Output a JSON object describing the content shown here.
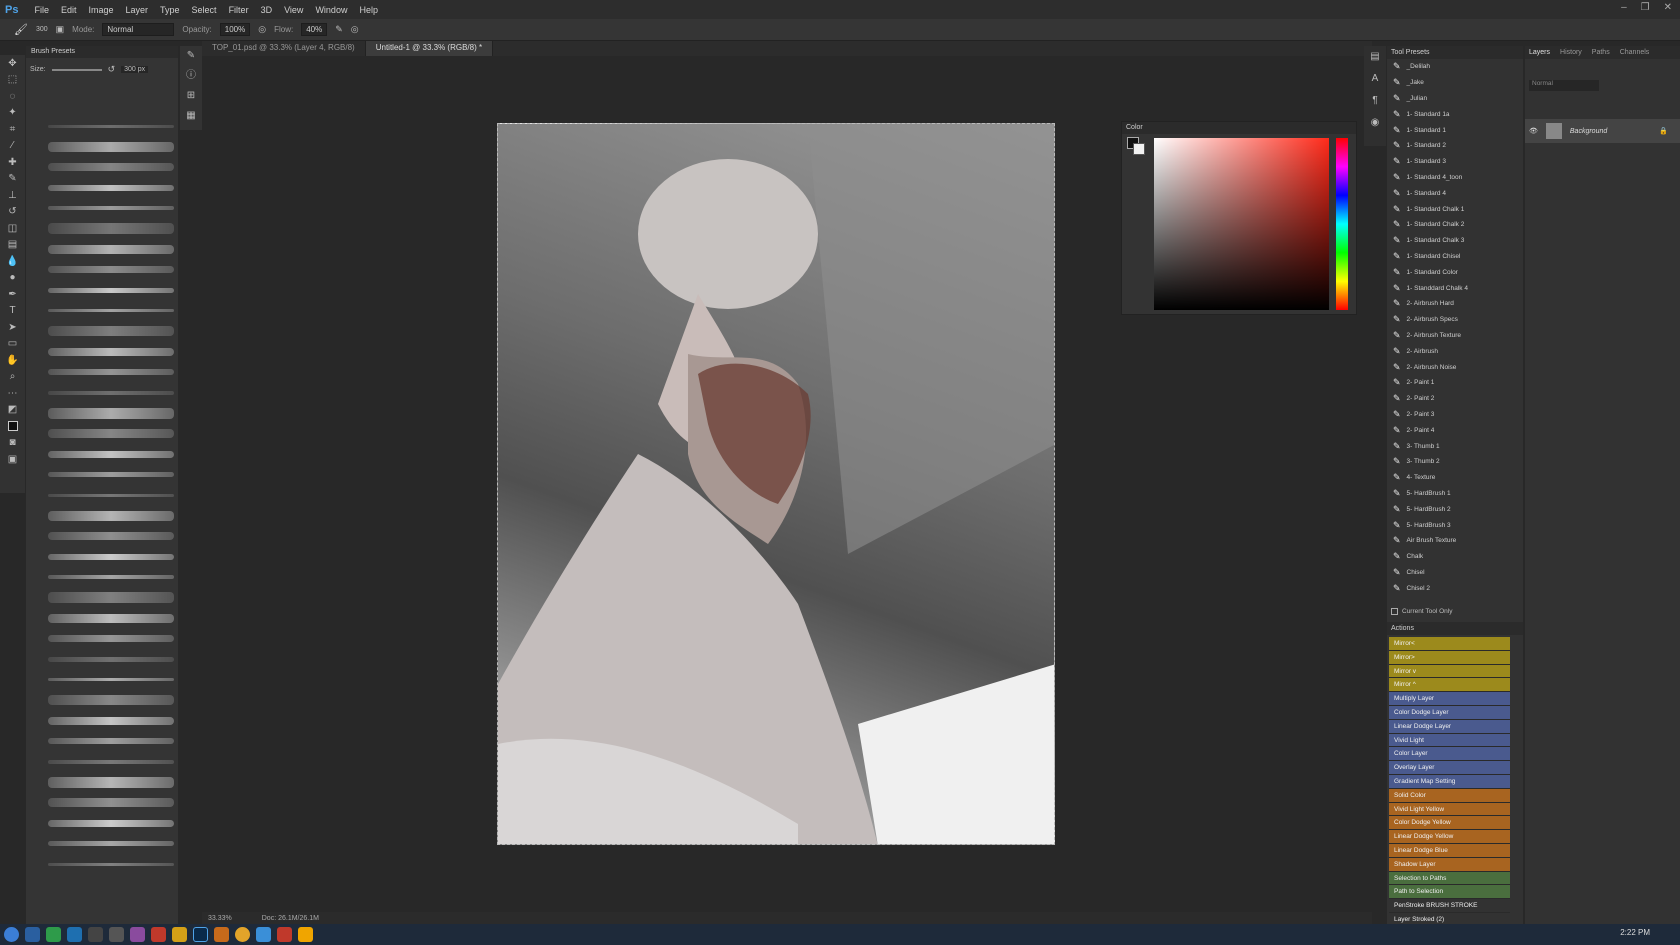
{
  "app": {
    "name": "Ps"
  },
  "menu": [
    "File",
    "Edit",
    "Image",
    "Layer",
    "Type",
    "Select",
    "Filter",
    "3D",
    "View",
    "Window",
    "Help"
  ],
  "options": {
    "brush_size": "300",
    "mode_label": "Mode:",
    "mode_value": "Normal",
    "opacity_label": "Opacity:",
    "opacity_value": "100%",
    "flow_label": "Flow:",
    "flow_value": "40%"
  },
  "brush_presets": {
    "title": "Brush Presets",
    "size_label": "Size:",
    "size_value": "300 px"
  },
  "tabs": [
    {
      "label": "TOP_01.psd @ 33.3% (Layer 4, RGB/8)"
    },
    {
      "label": "Untitled-1 @ 33.3% (RGB/8) *"
    }
  ],
  "color_panel": {
    "title": "Color"
  },
  "tool_presets": {
    "title": "Tool Presets",
    "items": [
      "_Delilah",
      "_Jake",
      "_Julian",
      "1- Standard 1a",
      "1- Standard 1",
      "1- Standard 2",
      "1- Standard 3",
      "1- Standard 4_toon",
      "1- Standard 4",
      "1- Standard Chalk 1",
      "1- Standard Chalk 2",
      "1- Standard Chalk 3",
      "1- Standard Chisel",
      "1- Standard Color",
      "1- Standdard Chalk 4",
      "2- Airbrush Hard",
      "2- Airbrush Specs",
      "2- Airbrush Texture",
      "2- Airbrush",
      "2- Airbrush Noise",
      "2- Paint 1",
      "2- Paint 2",
      "2- Paint 3",
      "2- Paint 4",
      "3- Thumb 1",
      "3- Thumb 2",
      "4- Texture",
      "5- HardBrush 1",
      "5- HardBrush 2",
      "5- HardBrush 3",
      "Air Brush Texture",
      "Chalk",
      "Chisel",
      "Chisel 2"
    ],
    "current_tool_only": "Current Tool Only"
  },
  "actions": {
    "title": "Actions",
    "items": [
      {
        "label": "Mirror<",
        "color": "#9c8a1c"
      },
      {
        "label": "Mirror>",
        "color": "#9c8a1c"
      },
      {
        "label": "Mirror v",
        "color": "#9c8a1c"
      },
      {
        "label": "Mirror ^",
        "color": "#9c8a1c"
      },
      {
        "label": "Multiply Layer",
        "color": "#4a5a8e"
      },
      {
        "label": "Color Dodge Layer",
        "color": "#4a5a8e"
      },
      {
        "label": "Linear Dodge Layer",
        "color": "#4a5a8e"
      },
      {
        "label": "Vivid Light",
        "color": "#4a5a8e"
      },
      {
        "label": "Color Layer",
        "color": "#4a5a8e"
      },
      {
        "label": "Overlay Layer",
        "color": "#4a5a8e"
      },
      {
        "label": "Gradient Map Setting",
        "color": "#4a5a8e"
      },
      {
        "label": "Solid Color",
        "color": "#a86420"
      },
      {
        "label": "Vivid Light Yellow",
        "color": "#a86420"
      },
      {
        "label": "Color Dodge Yellow",
        "color": "#a86420"
      },
      {
        "label": "Linear Dodge Yellow",
        "color": "#a86420"
      },
      {
        "label": "Linear Dodge Blue",
        "color": "#a86420"
      },
      {
        "label": "Shadow Layer",
        "color": "#a86420"
      },
      {
        "label": "Selection to Paths",
        "color": "#4a6e3e"
      },
      {
        "label": "Path to Selection",
        "color": "#4a6e3e"
      },
      {
        "label": "PenStroke BRUSH STROKE",
        "color": "#323232"
      },
      {
        "label": "Layer Stroked (2)",
        "color": "#323232"
      }
    ]
  },
  "layers": {
    "tabs": [
      "Layers",
      "History",
      "Paths",
      "Channels"
    ],
    "blend_mode": "Normal",
    "background_layer": "Background"
  },
  "status": {
    "zoom": "33.33%",
    "doc": "Doc: 26.1M/26.1M"
  },
  "taskbar": {
    "time": "2:22 PM"
  }
}
